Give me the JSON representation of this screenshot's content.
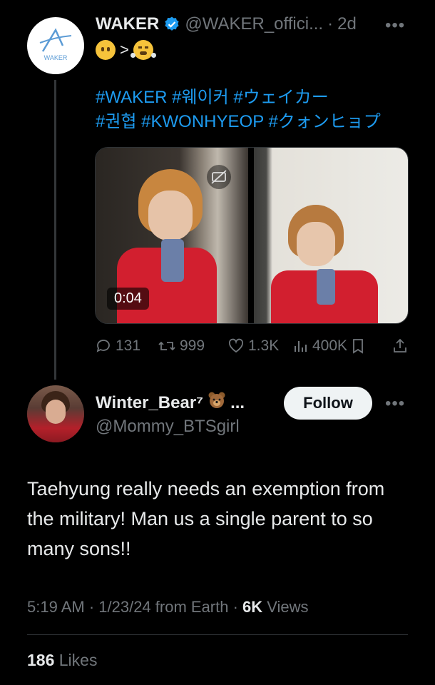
{
  "original_tweet": {
    "display_name": "WAKER",
    "handle": "@WAKER_offici...",
    "separator": "·",
    "time": "2d",
    "emoji_line": {
      "left_emoji": "no-mouth-face",
      "gt": ">",
      "right_emoji": "steam-face"
    },
    "hashtags_line1": "#WAKER #웨이커 #ウェイカー",
    "hashtags_line2": "#권협 #KWONHYEOP #クォンヒョプ",
    "avatar_logo_text": "WAKER",
    "video_time": "0:04",
    "stats": {
      "replies": "131",
      "retweets": "999",
      "likes": "1.3K",
      "views": "400K"
    }
  },
  "reply_tweet": {
    "display_name": "Winter_Bear⁷",
    "name_suffix": "...",
    "handle": "@Mommy_BTSgirl",
    "follow_label": "Follow",
    "text": "Taehyung really needs an exemption from the military! Man us a single parent to so many sons!!",
    "timestamp": "5:19 AM · 1/23/24 from Earth · ",
    "views_count": "6K",
    "views_label": " Views",
    "likes_count": "186",
    "likes_label": " Likes"
  },
  "colors": {
    "accent": "#1d9bf0",
    "muted": "#71767b",
    "text": "#e7e9ea",
    "bg": "#000000"
  }
}
